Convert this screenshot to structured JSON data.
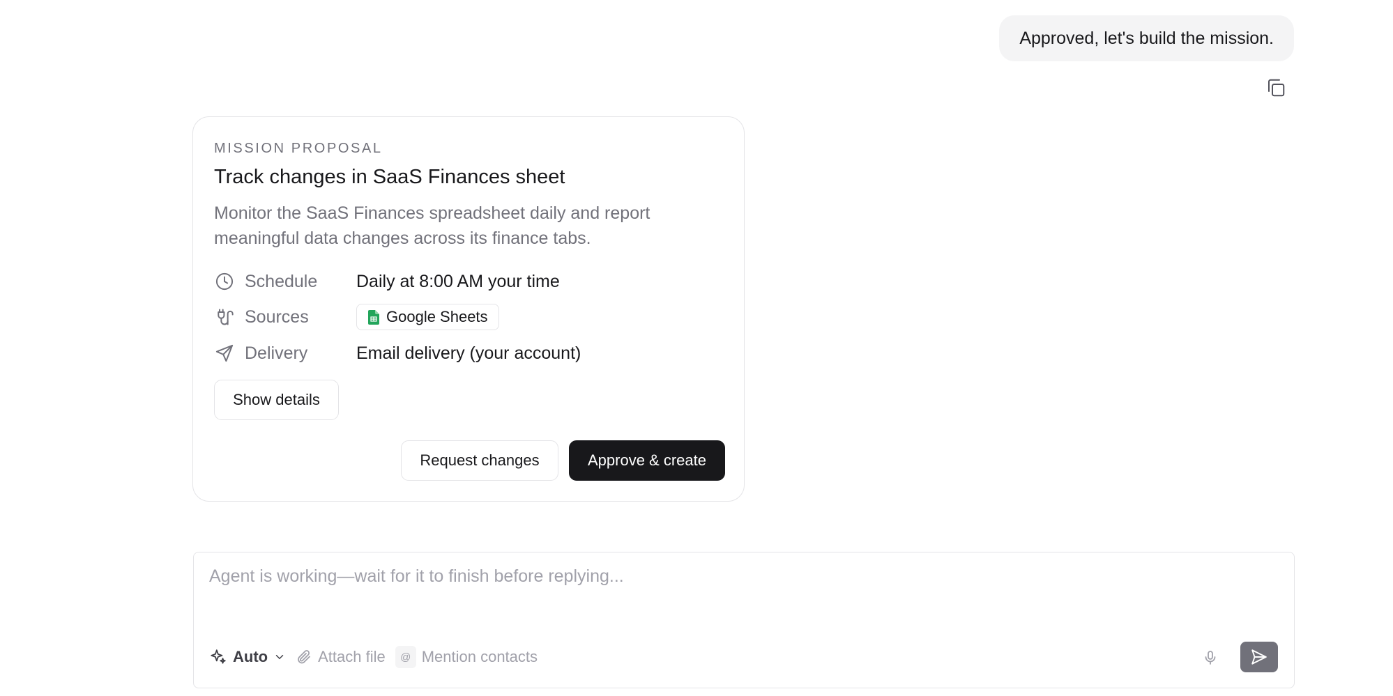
{
  "user_message": {
    "text": "Approved, let's build the mission."
  },
  "proposal": {
    "eyebrow": "MISSION PROPOSAL",
    "title": "Track changes in SaaS Finances sheet",
    "description": "Monitor the SaaS Finances spreadsheet daily and report meaningful data changes across its finance tabs.",
    "schedule": {
      "label": "Schedule",
      "value": "Daily at 8:00 AM your time",
      "icon": "clock-icon"
    },
    "sources": {
      "label": "Sources",
      "value": "Google Sheets",
      "icon": "plug-icon",
      "chip_icon": "google-sheets-icon"
    },
    "delivery": {
      "label": "Delivery",
      "value": "Email delivery (your account)",
      "icon": "send-icon"
    },
    "show_details_label": "Show details",
    "request_changes_label": "Request changes",
    "approve_label": "Approve & create"
  },
  "composer": {
    "placeholder": "Agent is working—wait for it to finish before replying...",
    "mode_label": "Auto",
    "attach_label": "Attach file",
    "mention_label": "Mention contacts",
    "mention_badge": "@"
  },
  "colors": {
    "accent_dark": "#18181b",
    "muted_text": "#71717a",
    "border": "#e4e4e7",
    "bubble_bg": "#f4f4f5",
    "sheets_green": "#22a55b",
    "send_bg": "#71717a"
  }
}
